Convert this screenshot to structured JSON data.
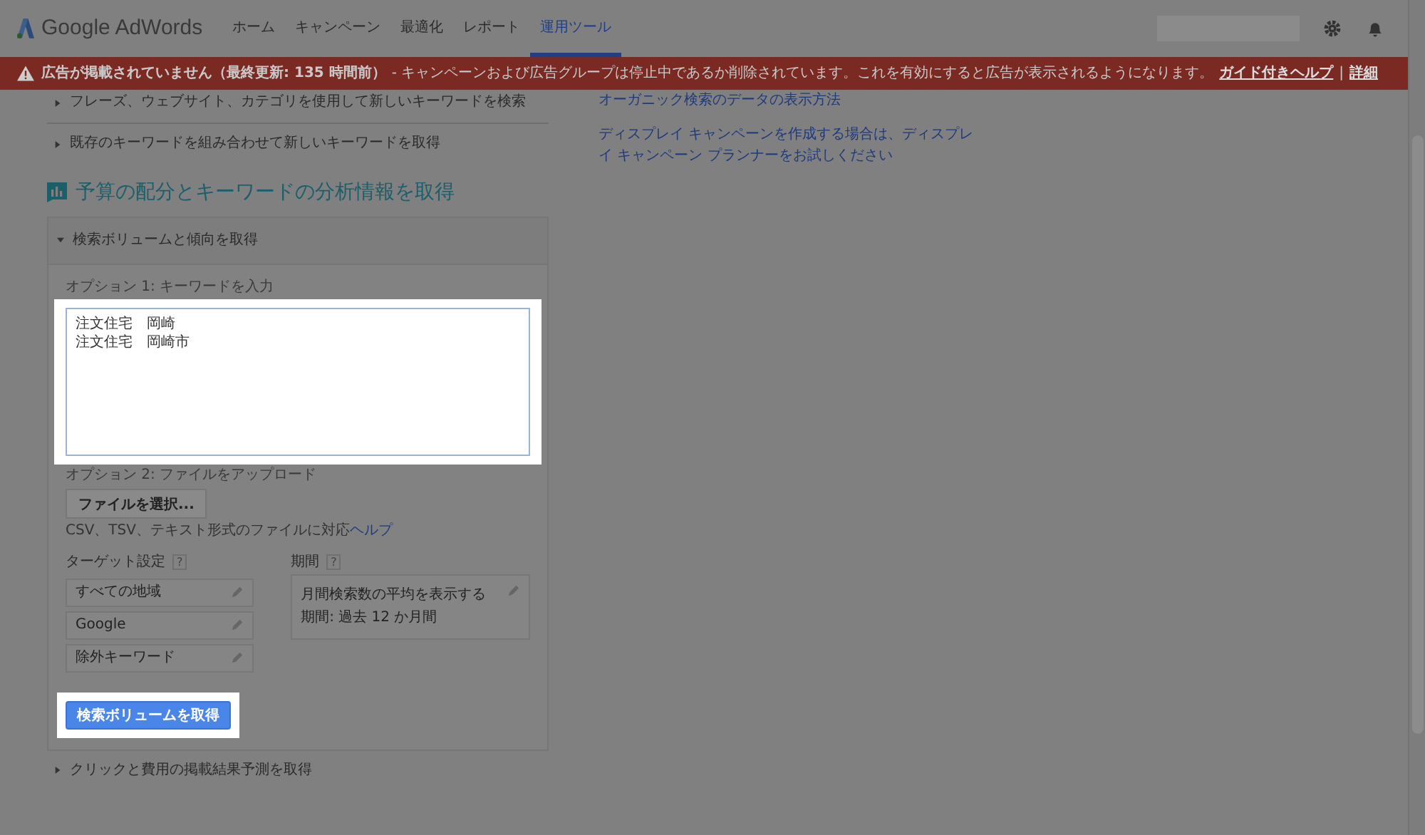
{
  "header": {
    "logo": "Google AdWords",
    "nav": [
      {
        "label": "ホーム",
        "selected": false
      },
      {
        "label": "キャンペーン",
        "selected": false
      },
      {
        "label": "最適化",
        "selected": false
      },
      {
        "label": "レポート",
        "selected": false
      },
      {
        "label": "運用ツール",
        "selected": true
      }
    ]
  },
  "alert": {
    "title": "広告が掲載されていません（最終更新: 135 時間前）",
    "message": "- キャンペーンおよび広告グループは停止中であるか削除されています。これを有効にすると広告が表示されるようになります。",
    "links": [
      "ガイド付きヘルプ",
      "詳細"
    ],
    "separator": "|"
  },
  "left_links": [
    {
      "label": "フレーズ、ウェブサイト、カテゴリを使用して新しいキーワードを検索"
    },
    {
      "label": "既存のキーワードを組み合わせて新しいキーワードを取得"
    }
  ],
  "right_links": [
    "オーガニック検索のデータの表示方法",
    "ディスプレイ キャンペーンを作成する場合は、ディスプレイ キャンペーン プランナーをお試しください"
  ],
  "section": {
    "title": "予算の配分とキーワードの分析情報を取得",
    "panel_header": "検索ボリュームと傾向を取得",
    "option1": "オプション 1: キーワードを入力",
    "keywords": [
      "注文住宅　岡崎",
      "注文住宅　岡崎市"
    ],
    "option2": "オプション 2: ファイルをアップロード",
    "file_button": "ファイルを選択...",
    "file_note": "CSV、TSV、テキスト形式のファイルに対応",
    "help_link": "ヘルプ",
    "targeting": {
      "label": "ターゲット設定",
      "help": "?",
      "items": [
        "すべての地域",
        "Google",
        "除外キーワード"
      ]
    },
    "period": {
      "label": "期間",
      "help": "?",
      "lines": [
        "月間検索数の平均を表示する",
        "期間: 過去 12 か月間"
      ]
    },
    "submit": "検索ボリュームを取得"
  },
  "next_section": "クリックと費用の掲載結果予測を取得"
}
